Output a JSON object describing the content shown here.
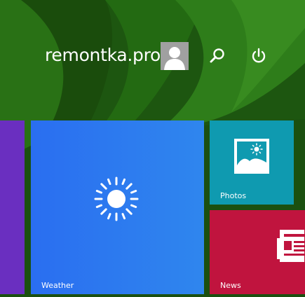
{
  "user": {
    "name": "remontka.pro"
  },
  "header": {
    "avatar_icon": "user-avatar-icon",
    "search_icon": "search-icon",
    "power_icon": "power-icon"
  },
  "tiles": {
    "weather": {
      "label": "Weather",
      "icon": "sun-icon",
      "color": "#2f7ff0"
    },
    "photos": {
      "label": "Photos",
      "icon": "photo-icon",
      "color": "#0f9ab0"
    },
    "news": {
      "label": "News",
      "icon": "newspaper-icon",
      "color": "#c0143e"
    },
    "partial": {
      "color": "#6a2fc0"
    }
  },
  "colors": {
    "background": "#1f5a12",
    "text": "#ffffff"
  }
}
